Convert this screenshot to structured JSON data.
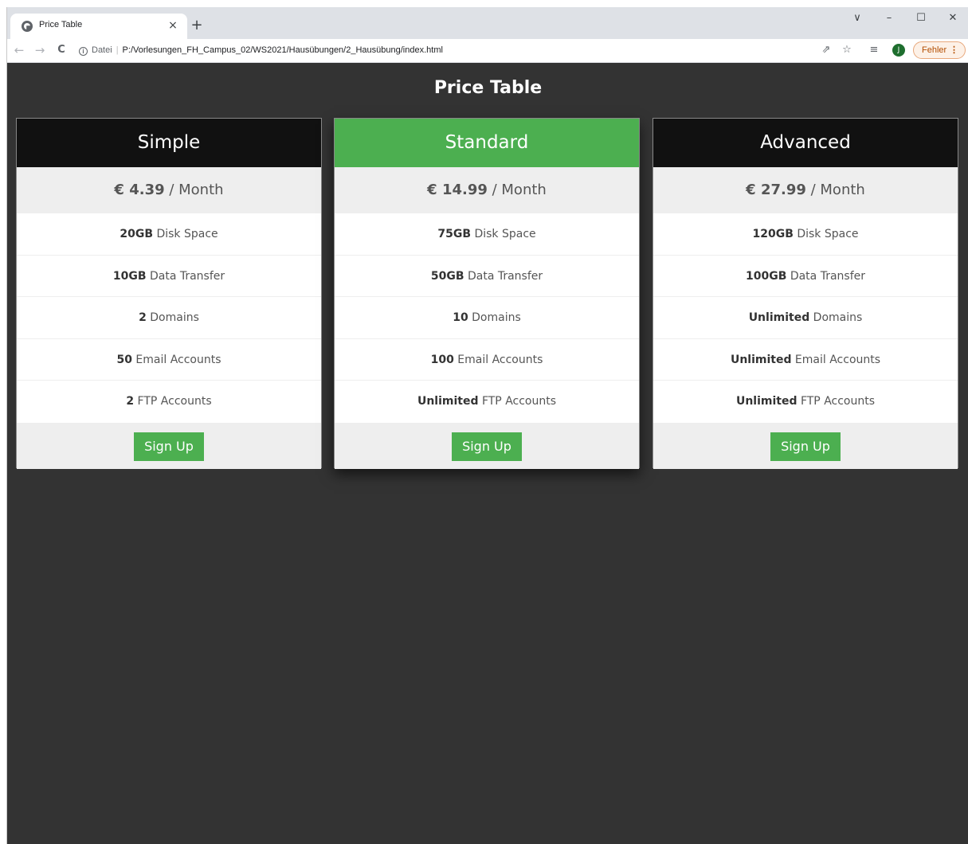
{
  "browser": {
    "tab_title": "Price Table",
    "tab_close": "×",
    "new_tab": "+",
    "window_controls": {
      "dropdown": "∨",
      "minimize": "–",
      "maximize": "☐",
      "close": "✕"
    },
    "nav": {
      "back": "←",
      "forward": "→",
      "reload": "C"
    },
    "omnibox": {
      "info": "i",
      "label": "Datei",
      "separator": "|",
      "url": "P:/Vorlesungen_FH_Campus_02/WS2021/Hausübungen/2_Hausübung/index.html"
    },
    "toolbar_icons": {
      "share": "⇗",
      "bookmark": "☆",
      "reading_list": "≡"
    },
    "avatar_letter": "J",
    "error_label": "Fehler",
    "error_menu": "⋮"
  },
  "page": {
    "title": "Price Table",
    "accent_color": "#4caf50",
    "plans": [
      {
        "name": "Simple",
        "price": "€ 4.39",
        "period": " / Month",
        "features": [
          {
            "value": "20GB",
            "label": " Disk Space"
          },
          {
            "value": "10GB",
            "label": " Data Transfer"
          },
          {
            "value": "2",
            "label": " Domains"
          },
          {
            "value": "50",
            "label": " Email Accounts"
          },
          {
            "value": "2",
            "label": " FTP Accounts"
          }
        ],
        "button": "Sign Up"
      },
      {
        "name": "Standard",
        "price": "€ 14.99",
        "period": " / Month",
        "features": [
          {
            "value": "75GB",
            "label": " Disk Space"
          },
          {
            "value": "50GB",
            "label": " Data Transfer"
          },
          {
            "value": "10",
            "label": " Domains"
          },
          {
            "value": "100",
            "label": " Email Accounts"
          },
          {
            "value": "Unlimited",
            "label": " FTP Accounts"
          }
        ],
        "button": "Sign Up"
      },
      {
        "name": "Advanced",
        "price": "€ 27.99",
        "period": " / Month",
        "features": [
          {
            "value": "120GB",
            "label": " Disk Space"
          },
          {
            "value": "100GB",
            "label": " Data Transfer"
          },
          {
            "value": "Unlimited",
            "label": " Domains"
          },
          {
            "value": "Unlimited",
            "label": " Email Accounts"
          },
          {
            "value": "Unlimited",
            "label": " FTP Accounts"
          }
        ],
        "button": "Sign Up"
      }
    ]
  }
}
